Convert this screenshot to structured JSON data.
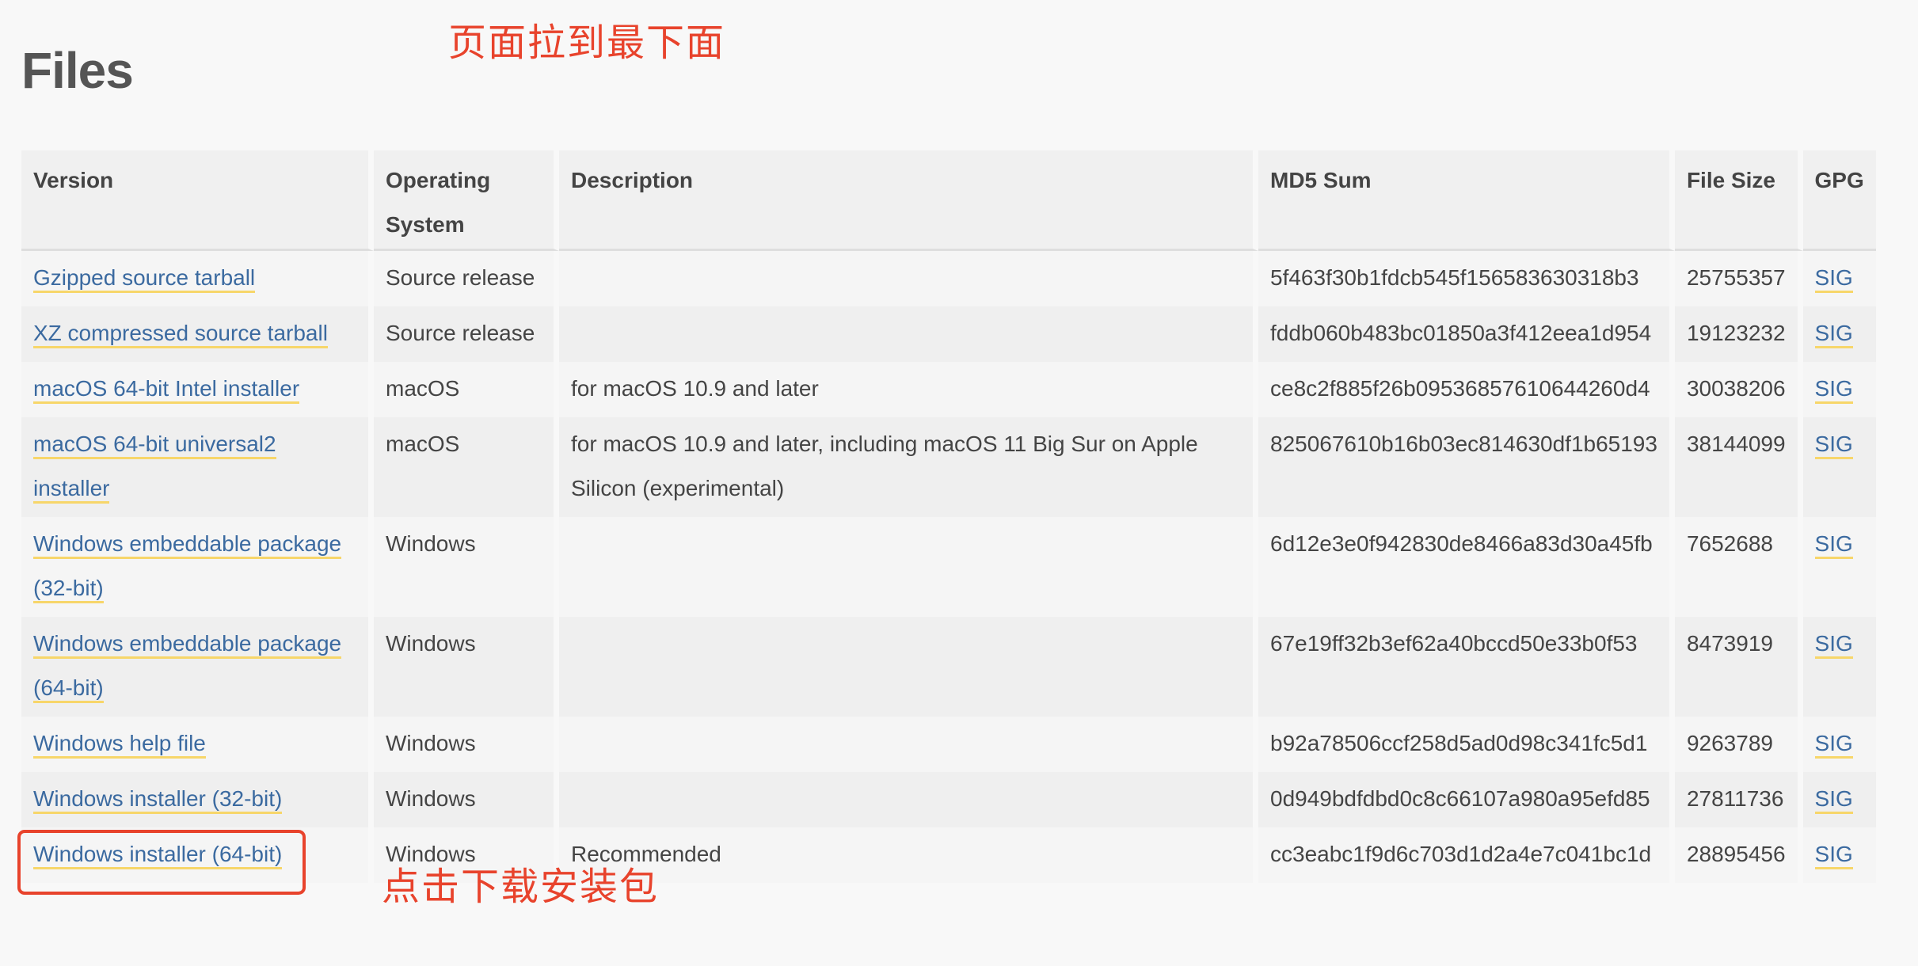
{
  "page": {
    "title": "Files"
  },
  "annotations": {
    "top": "页面拉到最下面",
    "bottom": "点击下载安装包"
  },
  "colors": {
    "link": "#3b6aa0",
    "link_underline": "#f7d66a",
    "annotation": "#e8432c"
  },
  "table": {
    "headers": [
      "Version",
      "Operating System",
      "Description",
      "MD5 Sum",
      "File Size",
      "GPG"
    ],
    "rows": [
      {
        "version": "Gzipped source tarball",
        "os": "Source release",
        "description": "",
        "md5": "5f463f30b1fdcb545f156583630318b3",
        "size": "25755357",
        "gpg": "SIG"
      },
      {
        "version": "XZ compressed source tarball",
        "os": "Source release",
        "description": "",
        "md5": "fddb060b483bc01850a3f412eea1d954",
        "size": "19123232",
        "gpg": "SIG"
      },
      {
        "version": "macOS 64-bit Intel installer",
        "os": "macOS",
        "description": "for macOS 10.9 and later",
        "md5": "ce8c2f885f26b09536857610644260d4",
        "size": "30038206",
        "gpg": "SIG"
      },
      {
        "version": "macOS 64-bit universal2 installer",
        "os": "macOS",
        "description": "for macOS 10.9 and later, including macOS 11 Big Sur on Apple Silicon (experimental)",
        "md5": "825067610b16b03ec814630df1b65193",
        "size": "38144099",
        "gpg": "SIG"
      },
      {
        "version": "Windows embeddable package (32-bit)",
        "os": "Windows",
        "description": "",
        "md5": "6d12e3e0f942830de8466a83d30a45fb",
        "size": "7652688",
        "gpg": "SIG"
      },
      {
        "version": "Windows embeddable package (64-bit)",
        "os": "Windows",
        "description": "",
        "md5": "67e19ff32b3ef62a40bccd50e33b0f53",
        "size": "8473919",
        "gpg": "SIG"
      },
      {
        "version": "Windows help file",
        "os": "Windows",
        "description": "",
        "md5": "b92a78506ccf258d5ad0d98c341fc5d1",
        "size": "9263789",
        "gpg": "SIG"
      },
      {
        "version": "Windows installer (32-bit)",
        "os": "Windows",
        "description": "",
        "md5": "0d949bdfdbd0c8c66107a980a95efd85",
        "size": "27811736",
        "gpg": "SIG"
      },
      {
        "version": "Windows installer (64-bit)",
        "os": "Windows",
        "description": "Recommended",
        "md5": "cc3eabc1f9d6c703d1d2a4e7c041bc1d",
        "size": "28895456",
        "gpg": "SIG"
      }
    ]
  }
}
